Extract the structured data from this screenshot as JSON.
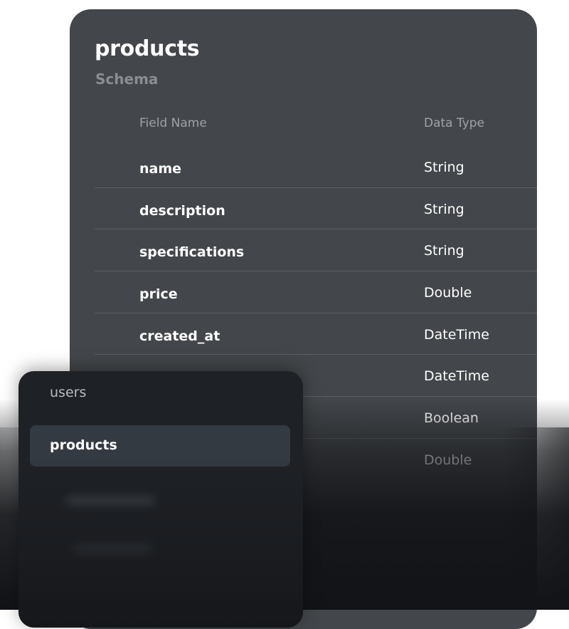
{
  "schema_panel": {
    "title": "products",
    "subtitle": "Schema",
    "columns": {
      "field": "Field Name",
      "type": "Data Type"
    },
    "rows": [
      {
        "field": "name",
        "type": "String"
      },
      {
        "field": "description",
        "type": "String"
      },
      {
        "field": "specifications",
        "type": "String"
      },
      {
        "field": "price",
        "type": "Double"
      },
      {
        "field": "created_at",
        "type": "DateTime"
      },
      {
        "field": "",
        "type": "DateTime"
      },
      {
        "field": "",
        "type": "Boolean"
      },
      {
        "field": "",
        "type": "Double"
      }
    ]
  },
  "collections_panel": {
    "items": [
      {
        "label": "users",
        "selected": false
      },
      {
        "label": "products",
        "selected": true
      }
    ]
  },
  "colors": {
    "panel_background": "#43464a",
    "list_background": "#1e2125",
    "selected_item": "#343a41"
  }
}
